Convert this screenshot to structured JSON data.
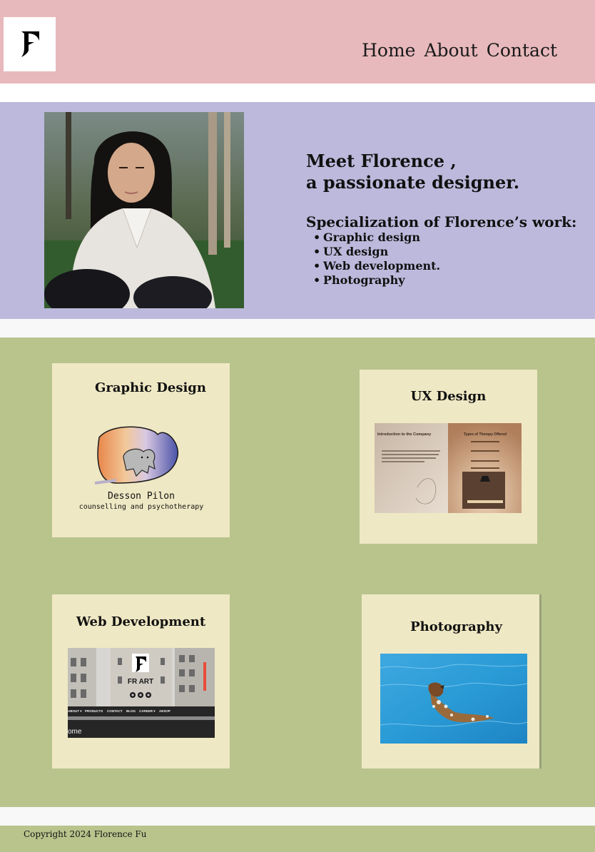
{
  "header": {
    "logo_alt": "F logo",
    "nav": [
      "Home",
      "About",
      "Contact"
    ]
  },
  "intro": {
    "title_line1": "Meet Florence ,",
    "title_line2": "a passionate designer.",
    "spec_heading": "Specialization of Florence’s work:",
    "spec_items": [
      "Graphic design",
      "UX design",
      "Web development.",
      "Photography"
    ]
  },
  "cards": [
    {
      "title": "Graphic Design",
      "thumb_text_1": "Desson Pilon",
      "thumb_text_2": "counselling and psychotherapy"
    },
    {
      "title": "UX Design",
      "thumb_left_heading": "Introduction to the Company",
      "thumb_right_heading": "Types of Therapy Offered"
    },
    {
      "title": "Web Development",
      "thumb_brand": "FR ART",
      "thumb_menu": [
        "ABOUT ▾",
        "PRODUCTS",
        "CONTACT",
        "BLOG",
        "CAREER ▾",
        "AESOP"
      ],
      "thumb_bottom": "ome"
    },
    {
      "title": "Photography"
    }
  ],
  "footer": {
    "copyright": "Copyright 2024 Florence Fu"
  },
  "colors": {
    "header_bg": "#e8b9bc",
    "intro_bg": "#bcb9dc",
    "portfolio_bg": "#b8c48c",
    "card_bg": "#efe8c4"
  }
}
